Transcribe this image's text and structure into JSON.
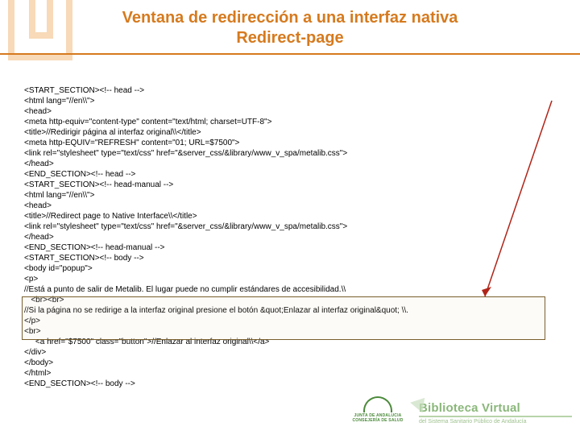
{
  "header": {
    "title_line1": "Ventana de redirección a una interfaz nativa",
    "title_line2": "Redirect-page"
  },
  "code": {
    "lines": [
      "<START_SECTION><!-- head -->",
      "<html lang=\"//en\\\\\">",
      "<head>",
      "<meta http-equiv=\"content-type\" content=\"text/html; charset=UTF-8\">",
      "<title>//Redirigir página al interfaz original\\\\</title>",
      "<meta http-EQUIV=\"REFRESH\" content=\"01; URL=$7500\">",
      "<link rel=\"stylesheet\" type=\"text/css\" href=\"&server_css/&library/www_v_spa/metalib.css\">",
      "</head>",
      "<END_SECTION><!-- head -->",
      "<START_SECTION><!-- head-manual -->",
      "<html lang=\"//en\\\\\">",
      "<head>",
      "<title>//Redirect page to Native Interface\\\\</title>",
      "<link rel=\"stylesheet\" type=\"text/css\" href=\"&server_css/&library/www_v_spa/metalib.css\">",
      "</head>",
      "<END_SECTION><!-- head-manual -->",
      "<START_SECTION><!-- body -->",
      "<body id=\"popup\">",
      "<p>",
      "//Está a punto de salir de Metalib. El lugar puede no cumplir estándares de accesibilidad.\\\\",
      "   <br><br>",
      "//Si la página no se redirige a la interfaz original presione el botón &quot;Enlazar al interfaz original&quot; \\\\.",
      "</p>",
      "<br>",
      "     <a href=\"$7500\" class=\"button\">//Enlazar al interfaz original\\\\</a>",
      "</div>",
      "</body>",
      "</html>",
      "<END_SECTION><!-- body -->"
    ]
  },
  "footer": {
    "junta": {
      "line1": "JUNTA DE ANDALUCIA",
      "line2": "CONSEJERÍA DE SALUD"
    },
    "bv": {
      "title": "Biblioteca Virtual",
      "sub": "del Sistema Sanitario Público de Andalucía"
    }
  }
}
